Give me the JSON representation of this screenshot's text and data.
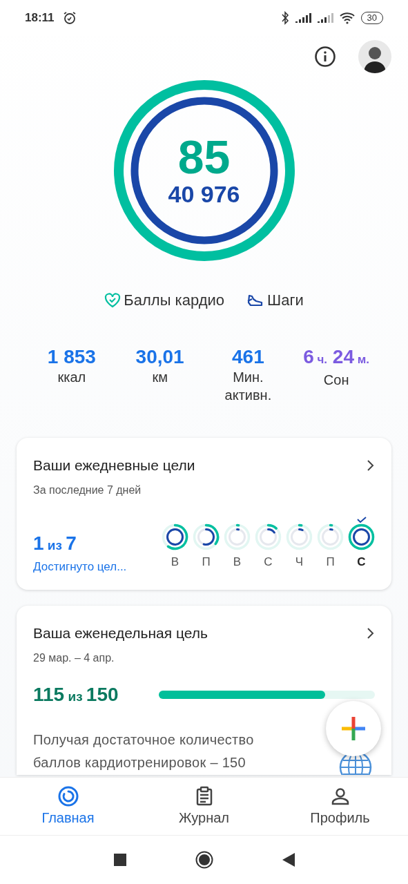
{
  "status_bar": {
    "time": "18:11",
    "battery": "30"
  },
  "summary": {
    "points": "85",
    "steps": "40 976"
  },
  "legend": [
    {
      "kind": "heart",
      "label": "Баллы кардио"
    },
    {
      "kind": "shoe",
      "label": "Шаги"
    }
  ],
  "stats": [
    {
      "value": "1 853",
      "label": "ккал",
      "kind": "plain"
    },
    {
      "value": "30,01",
      "label": "км",
      "kind": "plain"
    },
    {
      "value": "461",
      "label": "Мин. активн.",
      "kind": "plain"
    },
    {
      "kind": "sleep",
      "label": "Сон",
      "parts": [
        {
          "num": "6",
          "unit": "ч."
        },
        {
          "num": "24",
          "unit": "м."
        }
      ]
    }
  ],
  "daily_goals": {
    "title": "Ваши ежедневные цели",
    "subtitle": "За последние 7 дней",
    "count": "1",
    "of": "из",
    "total": "7",
    "caption": "Достигнуто цел...",
    "days": [
      {
        "label": "В",
        "achieved": false,
        "selected": false
      },
      {
        "label": "П",
        "achieved": false,
        "selected": false
      },
      {
        "label": "В",
        "achieved": false,
        "selected": false
      },
      {
        "label": "С",
        "achieved": false,
        "selected": false
      },
      {
        "label": "Ч",
        "achieved": false,
        "selected": false
      },
      {
        "label": "П",
        "achieved": false,
        "selected": false
      },
      {
        "label": "С",
        "achieved": true,
        "selected": true
      }
    ]
  },
  "weekly_goal": {
    "title": "Ваша еженедельная цель",
    "dates": "29 мар. – 4 апр.",
    "value": "115",
    "of": "из",
    "total": "150",
    "level": 0.77,
    "text_lines": [
      "Получая достаточное количество",
      "баллов кардиотренировок – 150"
    ]
  },
  "nav": [
    {
      "kind": "home",
      "label": "Главная",
      "selected": true
    },
    {
      "kind": "journal",
      "label": "Журнал",
      "selected": false
    },
    {
      "kind": "profile",
      "label": "Профиль",
      "selected": false
    }
  ]
}
